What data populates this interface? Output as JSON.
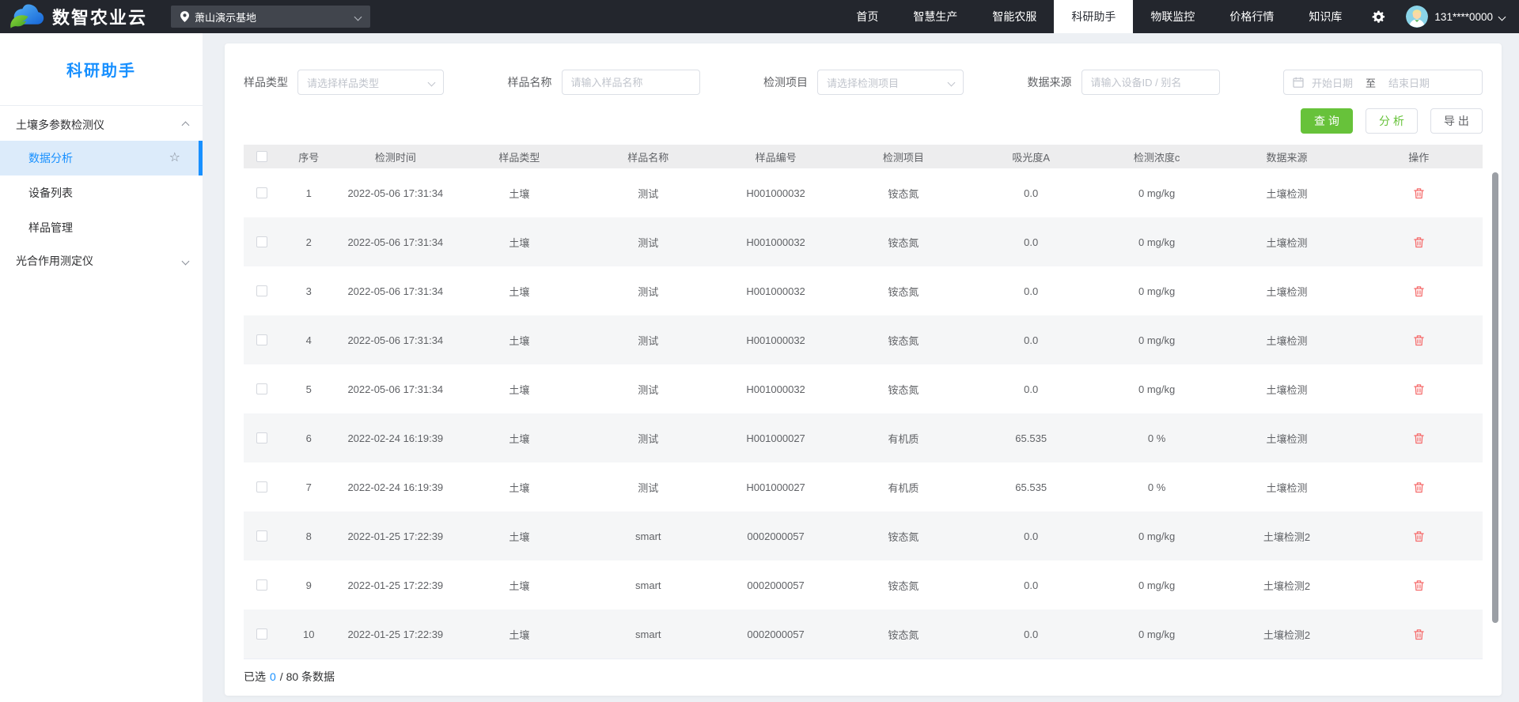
{
  "topbar": {
    "brand": "数智农业云",
    "base": {
      "name": "萧山演示基地"
    },
    "nav": [
      {
        "label": "首页"
      },
      {
        "label": "智慧生产"
      },
      {
        "label": "智能农服"
      },
      {
        "label": "科研助手",
        "active": true
      },
      {
        "label": "物联监控"
      },
      {
        "label": "价格行情"
      },
      {
        "label": "知识库"
      }
    ],
    "user": {
      "phone": "131****0000"
    }
  },
  "sidebar": {
    "title": "科研助手",
    "items": [
      {
        "label": "土壤多参数检测仪",
        "type": "group",
        "chevron": "up"
      },
      {
        "label": "数据分析",
        "type": "child",
        "active": true,
        "starred": true
      },
      {
        "label": "设备列表",
        "type": "child"
      },
      {
        "label": "样品管理",
        "type": "child"
      },
      {
        "label": "光合作用测定仪",
        "type": "group",
        "chevron": "down"
      }
    ]
  },
  "filters": {
    "sample_type": {
      "label": "样品类型",
      "placeholder": "请选择样品类型"
    },
    "sample_name": {
      "label": "样品名称",
      "placeholder": "请输入样品名称"
    },
    "test_item": {
      "label": "检测项目",
      "placeholder": "请选择检测项目"
    },
    "data_source": {
      "label": "数据来源",
      "placeholder": "请输入设备ID / 别名"
    },
    "date_range": {
      "start_placeholder": "开始日期",
      "separator": "至",
      "end_placeholder": "结束日期"
    }
  },
  "actions": {
    "query": "查 询",
    "analyze": "分 析",
    "export": "导 出"
  },
  "table": {
    "columns": [
      "序号",
      "检测时间",
      "样品类型",
      "样品名称",
      "样品编号",
      "检测项目",
      "吸光度A",
      "检测浓度c",
      "数据来源",
      "操作"
    ],
    "rows": [
      [
        "1",
        "2022-05-06 17:31:34",
        "土壤",
        "测试",
        "H001000032",
        "铵态氮",
        "0.0",
        "0 mg/kg",
        "土壤检测"
      ],
      [
        "2",
        "2022-05-06 17:31:34",
        "土壤",
        "测试",
        "H001000032",
        "铵态氮",
        "0.0",
        "0 mg/kg",
        "土壤检测"
      ],
      [
        "3",
        "2022-05-06 17:31:34",
        "土壤",
        "测试",
        "H001000032",
        "铵态氮",
        "0.0",
        "0 mg/kg",
        "土壤检测"
      ],
      [
        "4",
        "2022-05-06 17:31:34",
        "土壤",
        "测试",
        "H001000032",
        "铵态氮",
        "0.0",
        "0 mg/kg",
        "土壤检测"
      ],
      [
        "5",
        "2022-05-06 17:31:34",
        "土壤",
        "测试",
        "H001000032",
        "铵态氮",
        "0.0",
        "0 mg/kg",
        "土壤检测"
      ],
      [
        "6",
        "2022-02-24 16:19:39",
        "土壤",
        "测试",
        "H001000027",
        "有机质",
        "65.535",
        "0 %",
        "土壤检测"
      ],
      [
        "7",
        "2022-02-24 16:19:39",
        "土壤",
        "测试",
        "H001000027",
        "有机质",
        "65.535",
        "0 %",
        "土壤检测"
      ],
      [
        "8",
        "2022-01-25 17:22:39",
        "土壤",
        "smart",
        "0002000057",
        "铵态氮",
        "0.0",
        "0 mg/kg",
        "土壤检测2"
      ],
      [
        "9",
        "2022-01-25 17:22:39",
        "土壤",
        "smart",
        "0002000057",
        "铵态氮",
        "0.0",
        "0 mg/kg",
        "土壤检测2"
      ],
      [
        "10",
        "2022-01-25 17:22:39",
        "土壤",
        "smart",
        "0002000057",
        "铵态氮",
        "0.0",
        "0 mg/kg",
        "土壤检测2"
      ]
    ]
  },
  "footer": {
    "prefix": "已选",
    "count": "0",
    "suffix": "/ 80 条数据"
  },
  "icons": {
    "logo": "cloud-leaf-logo",
    "location": "location-pin-icon",
    "settings": "gear-icon",
    "favorite": "star-icon",
    "delete": "trash-icon",
    "calendar": "calendar-icon",
    "collapse": "chevron-icon"
  },
  "colors": {
    "accent_blue": "#1890ff",
    "accent_green": "#67c23a",
    "danger_red": "#f56c6c",
    "topbar_bg": "#23262d"
  }
}
